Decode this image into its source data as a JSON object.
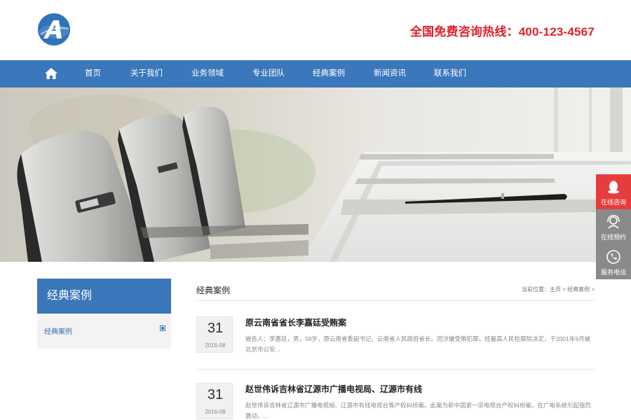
{
  "header": {
    "hotline": "全国免费咨询热线：400-123-4567",
    "logo_letter": "A"
  },
  "nav": {
    "items": [
      {
        "label": "首页"
      },
      {
        "label": "关于我们"
      },
      {
        "label": "业务领域"
      },
      {
        "label": "专业团队"
      },
      {
        "label": "经典案例"
      },
      {
        "label": "新闻资讯"
      },
      {
        "label": "联系我们"
      }
    ]
  },
  "float_bar": {
    "items": [
      {
        "label": "在线咨询",
        "icon": "qq-icon",
        "color": "#e83c3c"
      },
      {
        "label": "在线预约",
        "icon": "headset-icon",
        "color": "#8a8a8a"
      },
      {
        "label": "服务电话",
        "icon": "phone-icon",
        "color": "#8a8a8a"
      }
    ]
  },
  "sidebar": {
    "title": "经典案例",
    "items": [
      {
        "label": "经典案例"
      }
    ]
  },
  "main": {
    "title": "经典案例",
    "breadcrumb": {
      "prefix": "当前位置：",
      "home": "主页",
      "sep1": " > ",
      "current": "经典案例",
      "sep2": " >"
    },
    "articles": [
      {
        "day": "31",
        "ym": "2016-08",
        "title": "原云南省省长李嘉廷受贿案",
        "excerpt": "被告人：李嘉廷，男，58岁，原云南省委副书记、云南省人民政府省长。因涉嫌受贿犯罪，经最高人民检察院决定，于2001年9月被北京市公安..."
      },
      {
        "day": "31",
        "ym": "2016-08",
        "title": "赵世伟诉吉林省辽源市广播电视局、辽源市有线",
        "excerpt": "赵世伟诉吉林省辽源市广播电视局、辽源市有线电视台等产权纠纷案。此案为新中国第一宗电视台产权纠纷案，在广电系统引起强烈震动，..."
      }
    ]
  },
  "colors": {
    "brand_blue": "#3a77bb",
    "hotline_red": "#e0202a",
    "float_red": "#e83c3c",
    "float_gray": "#8a8a8a"
  }
}
